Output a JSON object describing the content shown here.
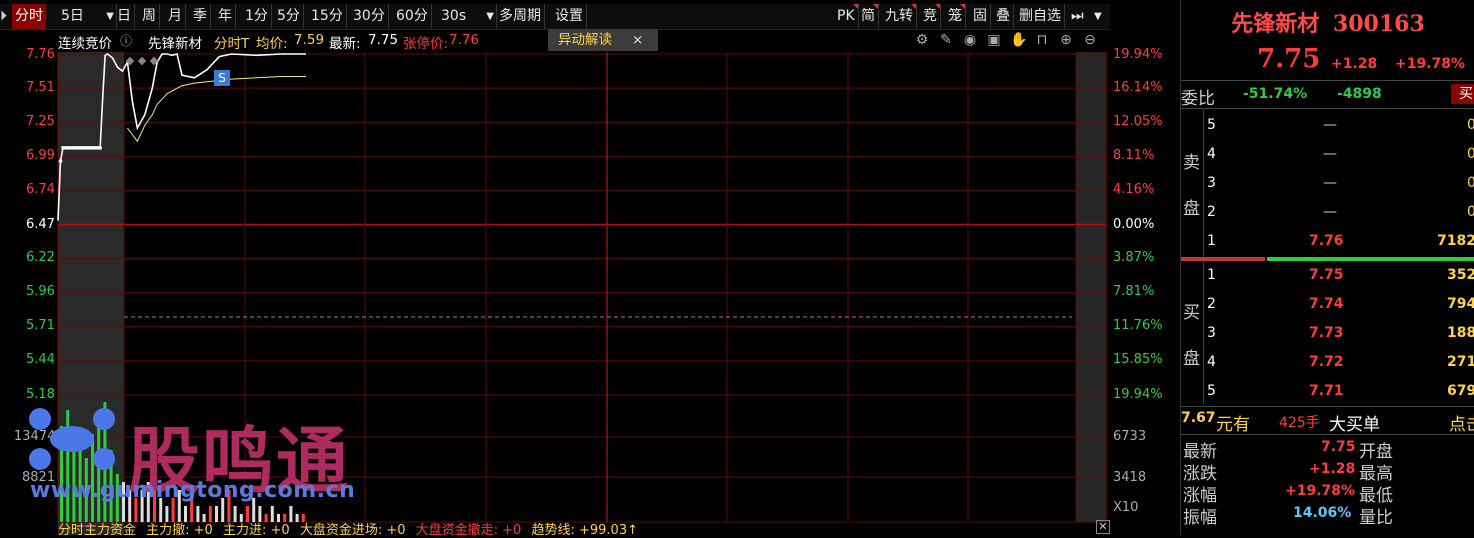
{
  "toolbar": {
    "items": [
      "分时",
      "5日",
      "日",
      "周",
      "月",
      "季",
      "年",
      "1分",
      "5分",
      "15分",
      "30分",
      "60分",
      "30s",
      "多周期",
      "设置"
    ],
    "right_items": [
      "PK",
      "简",
      "九转",
      "竞",
      "笼",
      "固",
      "叠",
      "删自选"
    ]
  },
  "info": {
    "auction_label": "连续竞价",
    "stock_name": "先锋新材",
    "chart_mode": "分时T",
    "avg_label": "均价:",
    "avg_value": "7.59",
    "latest_label": "最新:",
    "latest_value": "7.75",
    "limit_label": "张停价:",
    "limit_value": "7.76",
    "alert_button": "异动解读",
    "alert_close": "×"
  },
  "chart_data": {
    "type": "line",
    "y_left_ticks": [
      "7.76",
      "7.51",
      "7.25",
      "6.99",
      "6.74",
      "6.47",
      "6.22",
      "5.96",
      "5.71",
      "5.44",
      "5.18"
    ],
    "y_right_ticks": [
      "19.94%",
      "16.14%",
      "12.05%",
      "8.11%",
      "4.16%",
      "0.00%",
      "3.87%",
      "7.81%",
      "11.76%",
      "15.85%",
      "19.94%"
    ],
    "volume_left_ticks": [
      "13474",
      "8821"
    ],
    "volume_right_ticks": [
      "6733",
      "3418"
    ],
    "volume_unit": "X10",
    "prev_close": 6.47,
    "ylim": [
      5.18,
      7.76
    ],
    "series": [
      {
        "x": [
          0,
          1,
          2,
          3,
          4,
          5,
          6,
          7,
          8,
          9,
          10,
          11,
          12,
          13,
          14,
          15,
          16,
          17,
          18,
          19,
          20,
          22,
          24,
          26,
          28,
          30,
          32,
          35,
          38,
          40,
          42,
          44,
          46,
          48,
          50,
          55,
          60,
          65,
          70,
          80,
          90,
          100
        ],
        "values": [
          6.5,
          6.95,
          7.05,
          7.05,
          7.05,
          7.05,
          7.05,
          7.05,
          7.05,
          7.05,
          7.05,
          7.05,
          7.05,
          7.05,
          7.05,
          7.05,
          7.05,
          7.05,
          7.42,
          7.75,
          7.76,
          7.73,
          7.66,
          7.63,
          7.7,
          7.4,
          7.2,
          7.3,
          7.5,
          7.7,
          7.76,
          7.76,
          7.75,
          7.76,
          7.6,
          7.58,
          7.64,
          7.74,
          7.76,
          7.75,
          7.76,
          7.76
        ]
      },
      {
        "x": [
          28,
          30,
          32,
          35,
          38,
          40,
          42,
          44,
          46,
          48,
          50,
          55,
          60,
          65,
          70,
          80,
          90,
          100
        ],
        "values": [
          7.2,
          7.15,
          7.1,
          7.22,
          7.3,
          7.38,
          7.42,
          7.46,
          7.48,
          7.5,
          7.52,
          7.54,
          7.55,
          7.56,
          7.57,
          7.58,
          7.59,
          7.59
        ]
      }
    ],
    "volume_values": [
      12,
      14,
      10,
      9,
      8,
      11,
      13,
      15,
      9,
      6,
      5,
      4,
      3,
      4,
      5,
      4,
      3,
      2,
      3,
      4,
      2,
      3,
      2,
      1,
      2,
      2,
      3,
      4,
      2,
      1,
      2,
      3,
      2,
      1,
      2,
      1,
      1,
      2,
      1,
      1
    ]
  },
  "indicator": {
    "title": "分时主力资金",
    "main_out": "主力撤: +0",
    "main_in": "主力进: +0",
    "big_in": "大盘资金进场: +0",
    "big_out": "大盘资金撤走: +0",
    "trend": "趋势线: +99.03↑"
  },
  "watermark": {
    "text": "股鸣通",
    "url": "www.gumingtong.com.cn"
  },
  "panel": {
    "title": "先锋新材",
    "code": "300163",
    "price": "7.75",
    "change": "+1.28",
    "pct": "+19.78%",
    "weibi_label": "委比",
    "weibi": "-51.74%",
    "weicha": "-4898",
    "buy_btn": "买",
    "sell_label_1": "卖",
    "sell_label_2": "盘",
    "buy_label_1": "买",
    "buy_label_2": "盘",
    "asks": [
      {
        "lv": "5",
        "p": "—",
        "v": "0"
      },
      {
        "lv": "4",
        "p": "—",
        "v": "0"
      },
      {
        "lv": "3",
        "p": "—",
        "v": "0"
      },
      {
        "lv": "2",
        "p": "—",
        "v": "0"
      },
      {
        "lv": "1",
        "p": "7.76",
        "v": "7182"
      }
    ],
    "bids": [
      {
        "lv": "1",
        "p": "7.75",
        "v": "352"
      },
      {
        "lv": "2",
        "p": "7.74",
        "v": "794"
      },
      {
        "lv": "3",
        "p": "7.73",
        "v": "188"
      },
      {
        "lv": "4",
        "p": "7.72",
        "v": "271"
      },
      {
        "lv": "5",
        "p": "7.71",
        "v": "679"
      }
    ],
    "bigorder": {
      "price": "7.67",
      "unit1": "元有",
      "hands": "425手",
      "label": "大买单",
      "extra": "点击"
    },
    "stats": [
      {
        "k": "最新",
        "v": "7.75",
        "k2": "开盘"
      },
      {
        "k": "涨跌",
        "v": "+1.28",
        "k2": "最高"
      },
      {
        "k": "涨幅",
        "v": "+19.78%",
        "k2": "最低"
      },
      {
        "k": "振幅",
        "v": "14.06%",
        "k2": "量比"
      }
    ]
  }
}
